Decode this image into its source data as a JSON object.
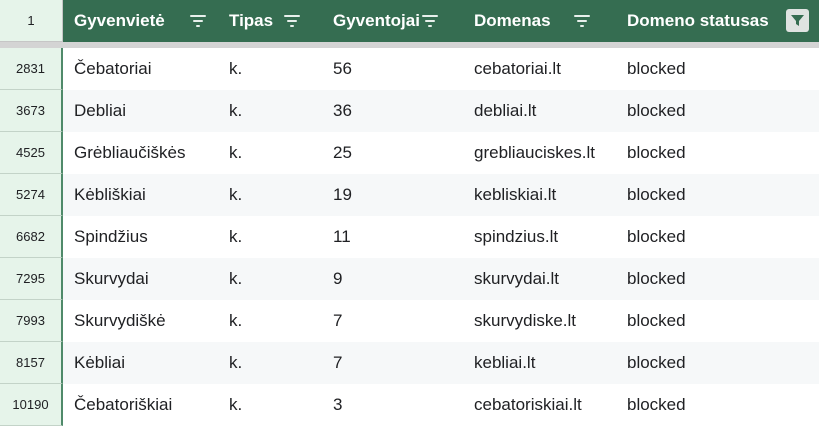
{
  "header": {
    "row_number": "1",
    "columns": [
      {
        "label": "Gyvenvietė",
        "filter": "filter-icon"
      },
      {
        "label": "Tipas",
        "filter": "filter-icon"
      },
      {
        "label": "Gyventojai",
        "filter": "filter-icon"
      },
      {
        "label": "Domenas",
        "filter": "filter-icon"
      },
      {
        "label": "Domeno statusas",
        "filter": "filter-active-icon"
      }
    ]
  },
  "rows": [
    {
      "num": "2831",
      "cells": [
        "Čebatoriai",
        "k.",
        "56",
        "cebatoriai.lt",
        "blocked"
      ]
    },
    {
      "num": "3673",
      "cells": [
        "Debliai",
        "k.",
        "36",
        "debliai.lt",
        "blocked"
      ]
    },
    {
      "num": "4525",
      "cells": [
        "Grėbliaučiškės",
        "k.",
        "25",
        "grebliauciskes.lt",
        "blocked"
      ]
    },
    {
      "num": "5274",
      "cells": [
        "Kėbliškiai",
        "k.",
        "19",
        "kebliskiai.lt",
        "blocked"
      ]
    },
    {
      "num": "6682",
      "cells": [
        "Spindžius",
        "k.",
        "11",
        "spindzius.lt",
        "blocked"
      ]
    },
    {
      "num": "7295",
      "cells": [
        "Skurvydai",
        "k.",
        "9",
        "skurvydai.lt",
        "blocked"
      ]
    },
    {
      "num": "7993",
      "cells": [
        "Skurvydiškė",
        "k.",
        "7",
        "skurvydiske.lt",
        "blocked"
      ]
    },
    {
      "num": "8157",
      "cells": [
        "Kėbliai",
        "k.",
        "7",
        "kebliai.lt",
        "blocked"
      ]
    },
    {
      "num": "10190",
      "cells": [
        "Čebatoriškiai",
        "k.",
        "3",
        "cebatoriskiai.lt",
        "blocked"
      ]
    }
  ],
  "colors": {
    "header_bg": "#356d51",
    "row_number_bg": "#e6f4ea",
    "alt_row_bg": "#f6f8f9"
  }
}
